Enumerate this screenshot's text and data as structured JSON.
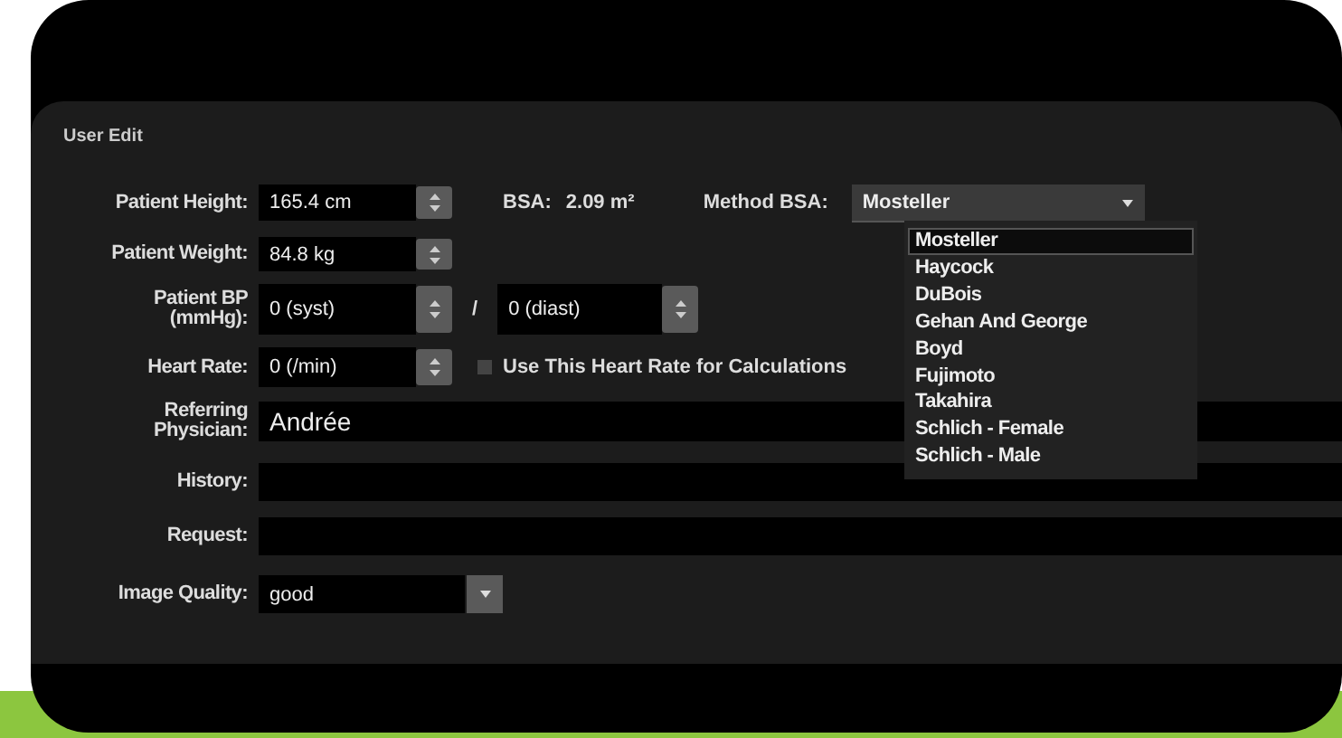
{
  "window": {
    "title": "User Edit"
  },
  "height": {
    "label": "Patient Height:",
    "value": "165.4 cm"
  },
  "bsa": {
    "label": "BSA:",
    "value": "2.09 m²"
  },
  "method_bsa": {
    "label": "Method BSA:",
    "value": "Mosteller",
    "expanded": true,
    "options": [
      {
        "label": "Mosteller",
        "selected": true
      },
      {
        "label": "Haycock",
        "selected": false
      },
      {
        "label": "DuBois",
        "selected": false
      },
      {
        "label": "Gehan And George",
        "selected": false
      },
      {
        "label": "Boyd",
        "selected": false
      },
      {
        "label": "Fujimoto",
        "selected": false
      },
      {
        "label": "Takahira",
        "selected": false
      },
      {
        "label": "Schlich - Female",
        "selected": false
      },
      {
        "label": "Schlich - Male",
        "selected": false
      }
    ]
  },
  "weight": {
    "label": "Patient Weight:",
    "value": "84.8 kg"
  },
  "blood_pressure": {
    "label": "Patient BP (mmHg):",
    "systolic": "0 (syst)",
    "separator": "/",
    "diastolic": "0 (diast)"
  },
  "heart_rate": {
    "label": "Heart Rate:",
    "value": "0 (/min)",
    "use_for_calculations": {
      "label": "Use This Heart Rate for Calculations",
      "checked": false
    }
  },
  "referring_physician": {
    "label": "Referring Physician:",
    "value": "Andrée"
  },
  "history": {
    "label": "History:"
  },
  "request": {
    "label": "Request:"
  },
  "image_quality": {
    "label": "Image Quality:",
    "value": "good"
  }
}
